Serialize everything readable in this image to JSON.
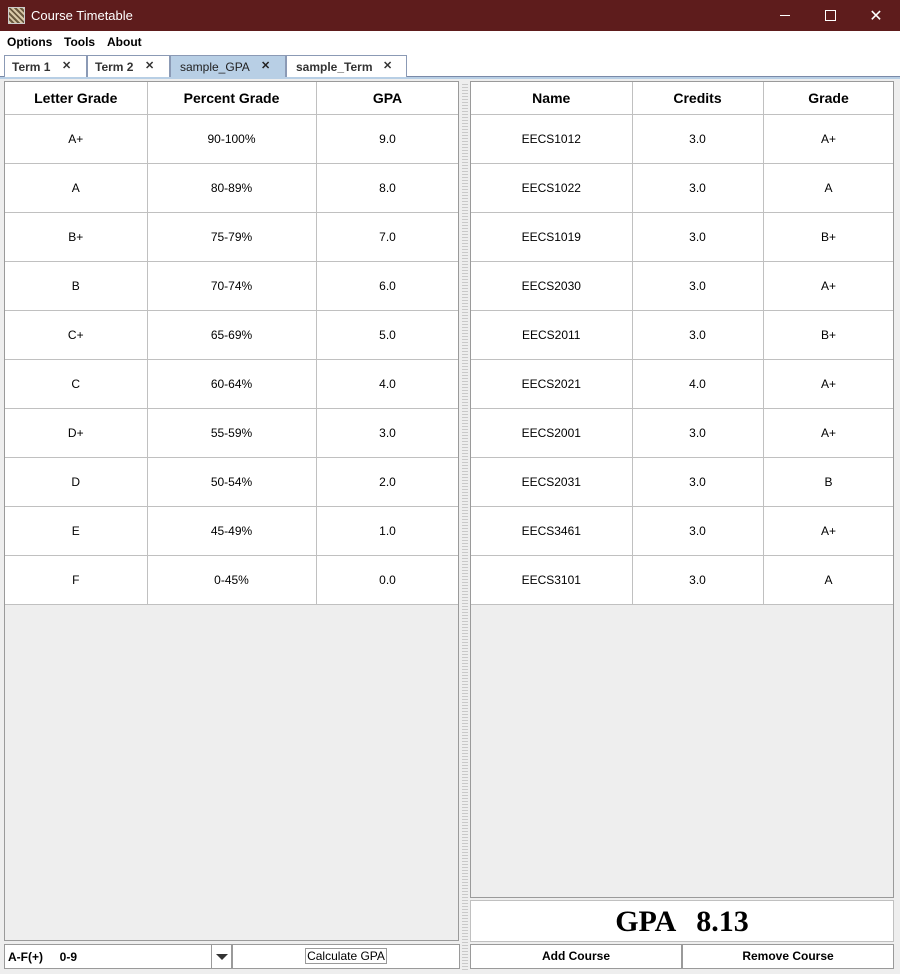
{
  "window": {
    "title": "Course Timetable"
  },
  "menu": [
    "Options",
    "Tools",
    "About"
  ],
  "tabs": [
    {
      "label": "Term 1",
      "active": false
    },
    {
      "label": "Term 2",
      "active": false
    },
    {
      "label": "sample_GPA",
      "active": true
    },
    {
      "label": "sample_Term",
      "active": false
    }
  ],
  "scale_table": {
    "headers": [
      "Letter Grade",
      "Percent Grade",
      "GPA"
    ],
    "rows": [
      [
        "A+",
        "90-100%",
        "9.0"
      ],
      [
        "A",
        "80-89%",
        "8.0"
      ],
      [
        "B+",
        "75-79%",
        "7.0"
      ],
      [
        "B",
        "70-74%",
        "6.0"
      ],
      [
        "C+",
        "65-69%",
        "5.0"
      ],
      [
        "C",
        "60-64%",
        "4.0"
      ],
      [
        "D+",
        "55-59%",
        "3.0"
      ],
      [
        "D",
        "50-54%",
        "2.0"
      ],
      [
        "E",
        "45-49%",
        "1.0"
      ],
      [
        "F",
        "0-45%",
        "0.0"
      ]
    ]
  },
  "course_table": {
    "headers": [
      "Name",
      "Credits",
      "Grade"
    ],
    "rows": [
      [
        "EECS1012",
        "3.0",
        "A+"
      ],
      [
        "EECS1022",
        "3.0",
        "A"
      ],
      [
        "EECS1019",
        "3.0",
        "B+"
      ],
      [
        "EECS2030",
        "3.0",
        "A+"
      ],
      [
        "EECS2011",
        "3.0",
        "B+"
      ],
      [
        "EECS2021",
        "4.0",
        "A+"
      ],
      [
        "EECS2001",
        "3.0",
        "A+"
      ],
      [
        "EECS2031",
        "3.0",
        "B"
      ],
      [
        "EECS3461",
        "3.0",
        "A+"
      ],
      [
        "EECS3101",
        "3.0",
        "A"
      ]
    ]
  },
  "gpa": {
    "label": "GPA",
    "value": "8.13"
  },
  "scale_select": {
    "value": "A-F(+)     0-9"
  },
  "buttons": {
    "calculate": "Calculate GPA",
    "add": "Add Course",
    "remove": "Remove Course"
  },
  "colors": {
    "titlebar": "#5e1c1c",
    "active_tab": "#b8cfe5"
  }
}
